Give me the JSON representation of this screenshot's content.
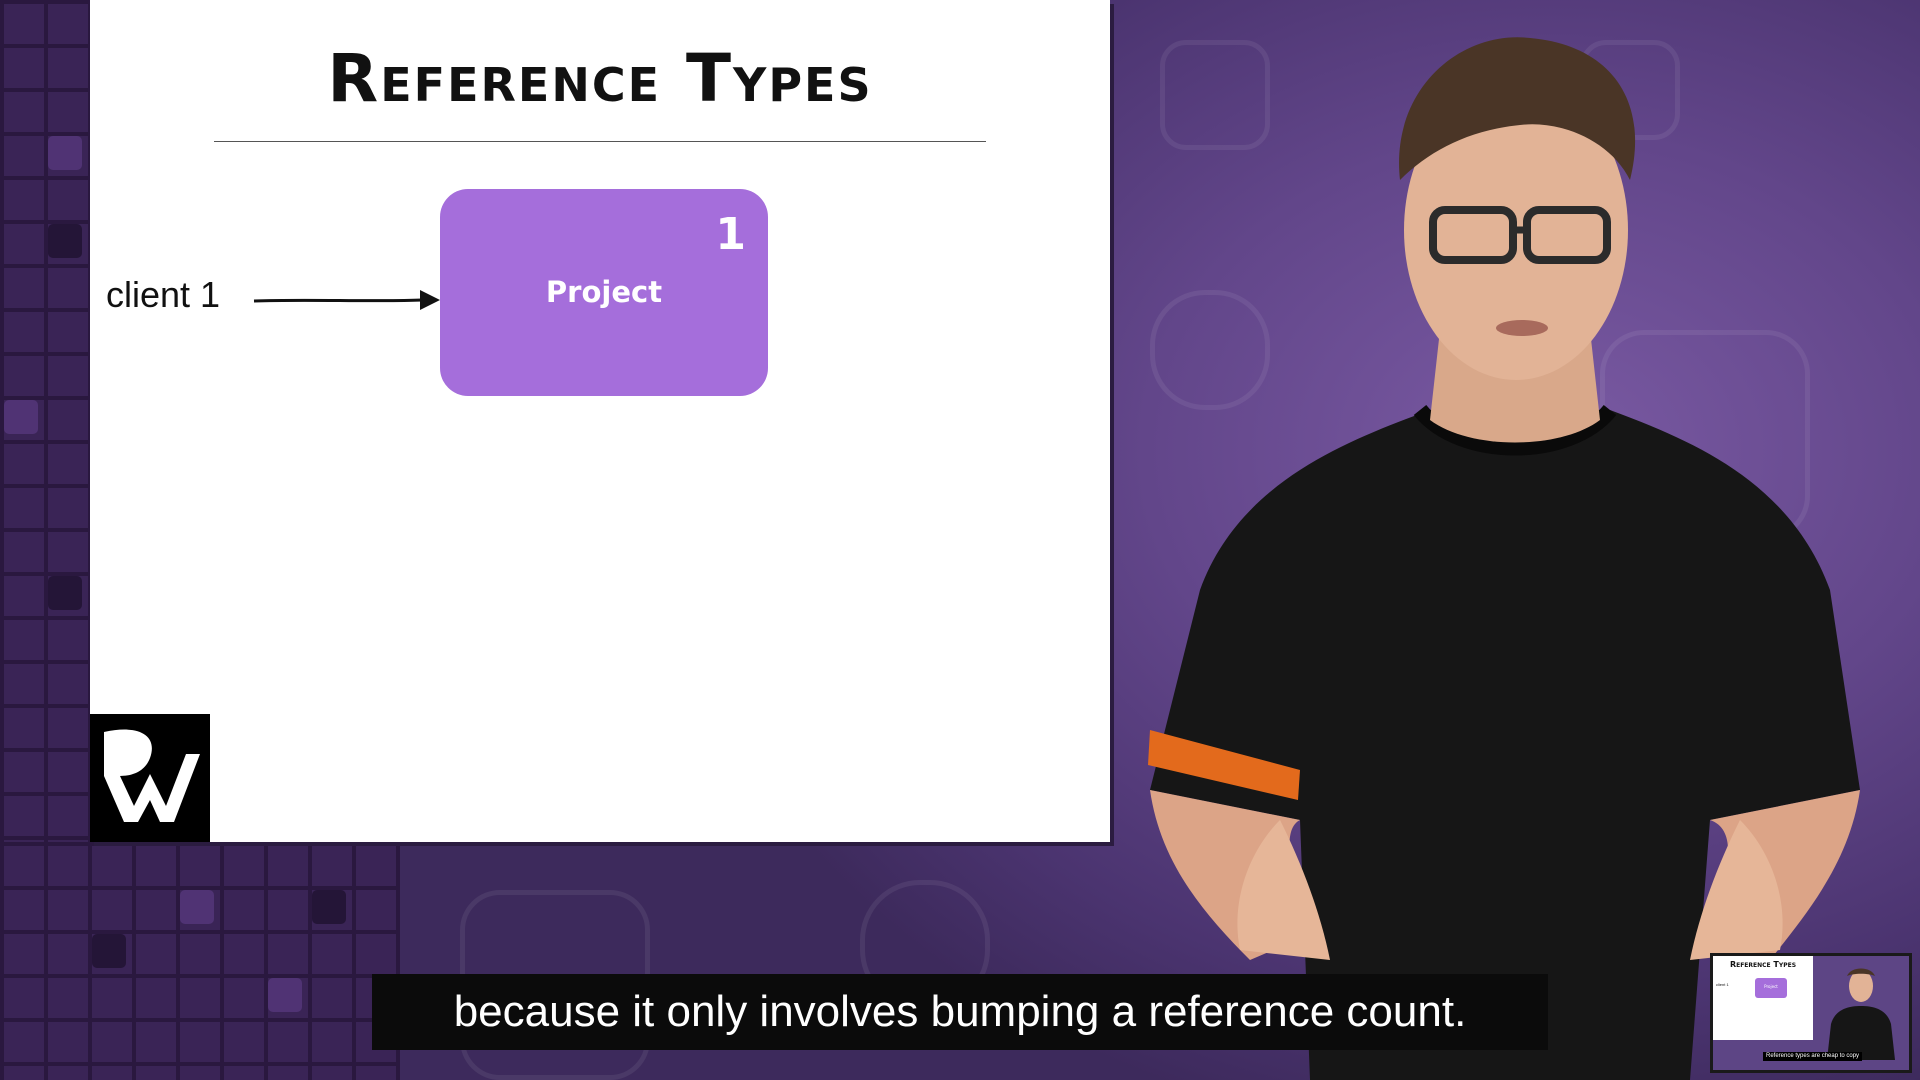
{
  "slide": {
    "title": "Reference Types",
    "client_label": "client 1",
    "box_label": "Project",
    "reference_count": "1",
    "box_color": "#a56edb",
    "logo": "rw-logo"
  },
  "caption": {
    "text": "because it only involves bumping a reference count."
  },
  "pip": {
    "title": "Reference Types",
    "client_label": "client 1",
    "box_label": "Project",
    "caption": "Reference types are cheap to copy"
  },
  "colors": {
    "background": "#5a3f80",
    "accent": "#a56edb",
    "caption_bg": "#0b0b0b"
  }
}
